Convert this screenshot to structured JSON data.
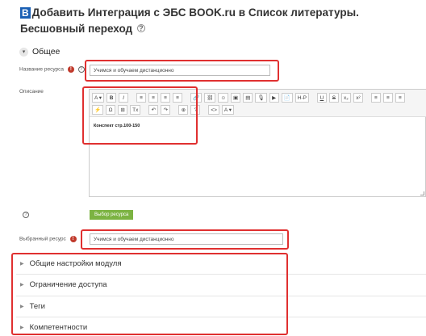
{
  "header": {
    "brand_badge": "B",
    "title": "Добавить Интеграция с ЭБС BOOK.ru в Список литературы. Бесшовный переход",
    "help_icon": "?"
  },
  "section_general": {
    "toggle_icon": "▾",
    "label": "Общее"
  },
  "resource_name": {
    "label": "Название ресурса",
    "value": "Учимся и обучаем дистанционно"
  },
  "description": {
    "label": "Описание",
    "toolbar_row1": [
      "A ▾",
      "B",
      "I",
      "≡",
      "≡",
      "≡",
      "≡",
      "🔗",
      "⛓",
      "☺",
      "▣",
      "▤",
      "🎙",
      "▶",
      "📄",
      "H-P",
      "U",
      "S",
      "x₂",
      "x²",
      "≡",
      "≡",
      "≡"
    ],
    "toolbar_row2": [
      "⚡",
      "Ω",
      "⊞",
      "Tx",
      "↶",
      "↷",
      "⊕",
      "?",
      "<>",
      "A ▾"
    ],
    "content": "Конспект стр.100-150"
  },
  "choose_row": {
    "help_icon": "?",
    "button_label": "Выбор ресурса"
  },
  "selected_resource": {
    "label": "Выбранный ресурс",
    "value": "Учимся и обучаем дистанционно"
  },
  "collapsed_sections": [
    {
      "label": "Общие настройки модуля"
    },
    {
      "label": "Ограничение доступа"
    },
    {
      "label": "Теги"
    },
    {
      "label": "Компетентности"
    }
  ],
  "colors": {
    "highlight": "#e03030",
    "choose_button": "#7cb342",
    "required": "#c0392b"
  }
}
